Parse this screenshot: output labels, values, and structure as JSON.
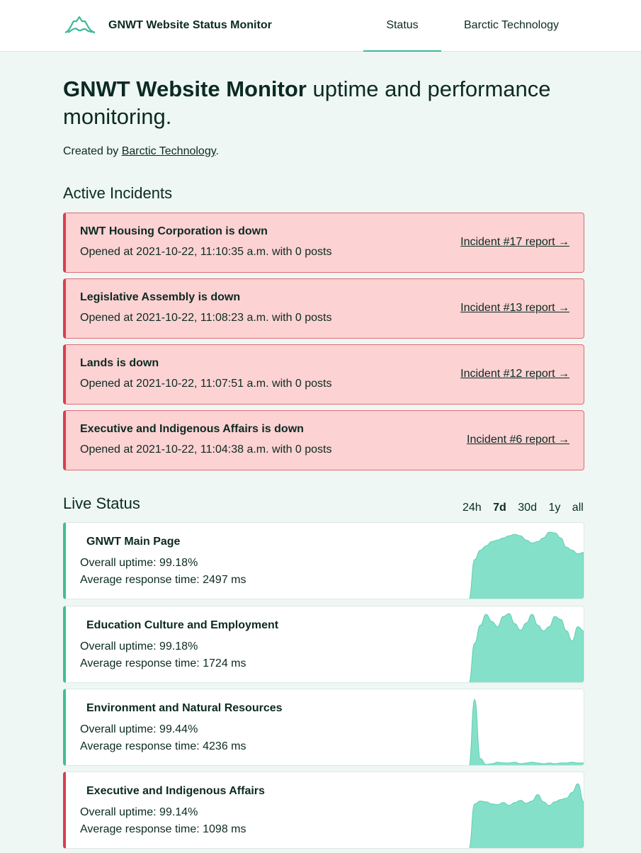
{
  "header": {
    "brand": "GNWT Website Status Monitor",
    "logo_icon": "mountain-wave-logo",
    "nav": [
      {
        "label": "Status",
        "active": true
      },
      {
        "label": "Barctic Technology",
        "active": false
      }
    ]
  },
  "hero": {
    "title_bold": "GNWT Website Monitor",
    "title_rest": " uptime and performance monitoring.",
    "created_prefix": "Created by ",
    "created_link": "Barctic Technology",
    "created_suffix": "."
  },
  "active_incidents": {
    "title": "Active Incidents",
    "items": [
      {
        "title": "NWT Housing Corporation is down",
        "meta": "Opened at 2021-10-22, 11:10:35 a.m. with 0 posts",
        "link": "Incident #17 report →"
      },
      {
        "title": "Legislative Assembly is down",
        "meta": "Opened at 2021-10-22, 11:08:23 a.m. with 0 posts",
        "link": "Incident #13 report →"
      },
      {
        "title": "Lands is down",
        "meta": "Opened at 2021-10-22, 11:07:51 a.m. with 0 posts",
        "link": "Incident #12 report →"
      },
      {
        "title": "Executive and Indigenous Affairs is down",
        "meta": "Opened at 2021-10-22, 11:04:38 a.m. with 0 posts",
        "link": "Incident #6 report →"
      }
    ]
  },
  "live_status": {
    "title": "Live Status",
    "ranges": [
      "24h",
      "7d",
      "30d",
      "1y",
      "all"
    ],
    "active_range": "7d",
    "sites": [
      {
        "name": "GNWT Main Page",
        "uptime": "Overall uptime:  99.18%",
        "response": "Average response time:  2497 ms",
        "status": "up",
        "spark": [
          0,
          0.55,
          0.68,
          0.74,
          0.8,
          0.82,
          0.85,
          0.88,
          0.9,
          0.88,
          0.82,
          0.78,
          0.8,
          0.85,
          0.93,
          0.92,
          0.85,
          0.72,
          0.68,
          0.63,
          0.65
        ]
      },
      {
        "name": "Education Culture and Employment",
        "uptime": "Overall uptime:  99.18%",
        "response": "Average response time:  1724 ms",
        "status": "up",
        "spark": [
          0,
          0.55,
          0.8,
          0.95,
          0.85,
          0.78,
          0.92,
          0.96,
          0.82,
          0.73,
          0.83,
          0.95,
          0.8,
          0.72,
          0.78,
          0.92,
          0.88,
          0.72,
          0.58,
          0.78,
          0.72
        ]
      },
      {
        "name": "Environment and Natural Resources",
        "uptime": "Overall uptime:  99.44%",
        "response": "Average response time:  4236 ms",
        "status": "up",
        "spark": [
          0,
          0.92,
          0.1,
          0.02,
          0.03,
          0.05,
          0.04,
          0.04,
          0.05,
          0.03,
          0.04,
          0.05,
          0.04,
          0.03,
          0.04,
          0.03,
          0.04,
          0.04,
          0.05,
          0.04,
          0.04
        ]
      },
      {
        "name": "Executive and Indigenous Affairs",
        "uptime": "Overall uptime:  99.14%",
        "response": "Average response time:  1098 ms",
        "status": "down",
        "spark": [
          0,
          0.62,
          0.66,
          0.65,
          0.62,
          0.61,
          0.64,
          0.6,
          0.64,
          0.67,
          0.63,
          0.66,
          0.75,
          0.65,
          0.6,
          0.65,
          0.68,
          0.7,
          0.78,
          0.9,
          0.65
        ]
      }
    ]
  },
  "colors": {
    "accent": "#3cb89a",
    "spark_fill": "#85e0ca",
    "spark_stroke": "#5fcfb3",
    "incident_bg": "#fdd2d3",
    "incident_border": "#dc3d50",
    "page_bg": "#eef7f4"
  }
}
